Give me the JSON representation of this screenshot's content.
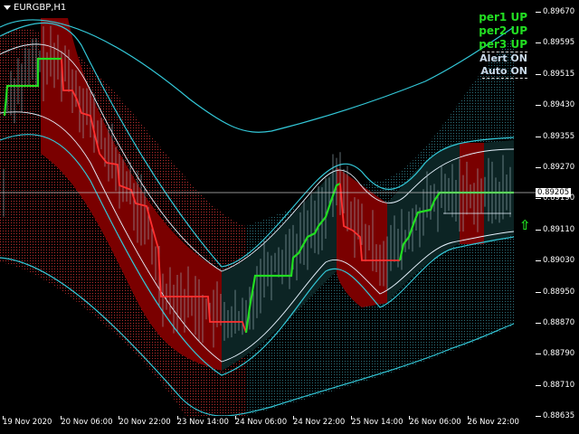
{
  "window": {
    "symbol_label": "EURGBP,H1",
    "symbol_icon": "dropdown-triangle-icon"
  },
  "panel": {
    "per1": "per1 UP",
    "per2": "per2 UP",
    "per3": "per3 UP",
    "alert": "Alert ON",
    "auto": "Auto ON"
  },
  "price_axis": {
    "labels": [
      "0.89670",
      "0.89595",
      "0.89515",
      "0.89430",
      "0.89355",
      "0.89270",
      "0.89190",
      "0.89110",
      "0.89030",
      "0.88950",
      "0.88870",
      "0.88790",
      "0.88710",
      "0.88635"
    ],
    "current_price": "0.89205"
  },
  "time_axis": {
    "labels": [
      "19 Nov 2020",
      "20 Nov 06:00",
      "20 Nov 22:00",
      "23 Nov 14:00",
      "24 Nov 06:00",
      "24 Nov 22:00",
      "25 Nov 14:00",
      "26 Nov 06:00",
      "26 Nov 22:00"
    ]
  },
  "colors": {
    "background": "#000000",
    "bear_zone": "#7a0000",
    "bull_zone": "#0c2424",
    "bear_line": "#ff3030",
    "bull_line": "#22dd22",
    "band": "#33c8d8",
    "band_inner": "#e8f4ff",
    "candles": "#9fb6bf"
  },
  "chart_data": {
    "type": "line",
    "title": "",
    "xlabel": "",
    "ylabel": "",
    "ylim": [
      0.88635,
      0.8967
    ],
    "x": [
      "19 Nov 2020",
      "20 Nov 06:00",
      "20 Nov 22:00",
      "23 Nov 14:00",
      "24 Nov 06:00",
      "24 Nov 22:00",
      "25 Nov 14:00",
      "26 Nov 06:00",
      "26 Nov 22:00"
    ],
    "series": [
      {
        "values": [
          0.8953,
          0.8937,
          0.8912,
          0.889,
          0.8905,
          0.8926,
          0.8902,
          0.892,
          0.892
        ]
      }
    ],
    "current_price": 0.89205
  }
}
